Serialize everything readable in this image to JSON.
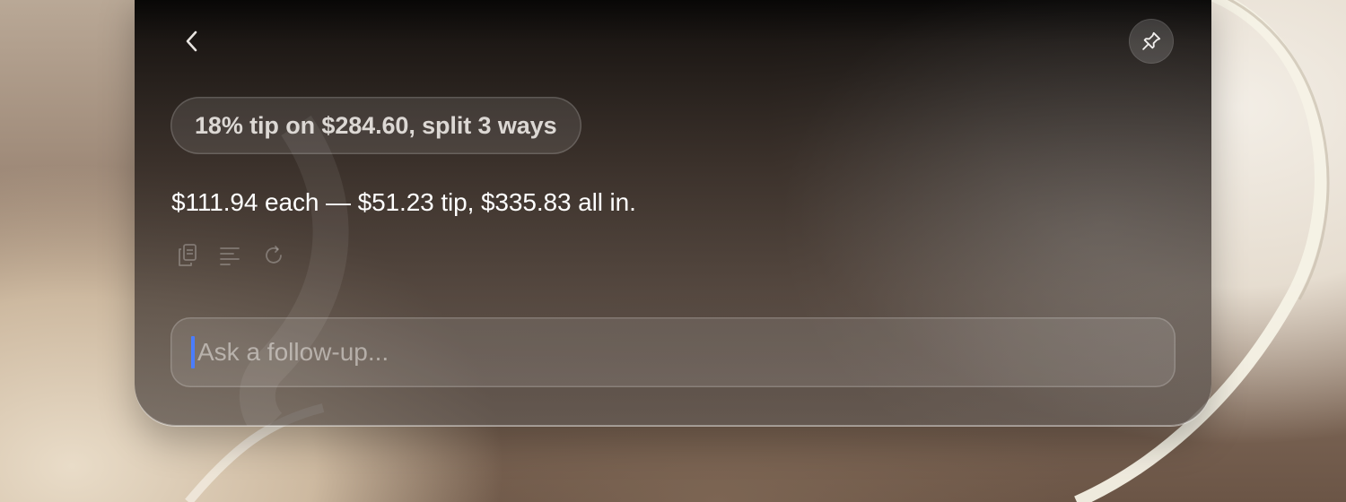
{
  "header": {
    "back_icon": "chevron-left-icon",
    "pin_icon": "pin-icon"
  },
  "query": {
    "text": "18% tip on $284.60, split 3 ways"
  },
  "answer": {
    "text": "$111.94 each — $51.23 tip, $335.83 all in."
  },
  "actions": [
    {
      "icon": "copy-icon"
    },
    {
      "icon": "text-lines-icon"
    },
    {
      "icon": "refresh-icon"
    }
  ],
  "followup": {
    "placeholder": "Ask a follow-up...",
    "value": ""
  },
  "colors": {
    "caret": "#4a7dff",
    "answer_text": "#ffffff",
    "chip_text": "#dcd8d4"
  }
}
